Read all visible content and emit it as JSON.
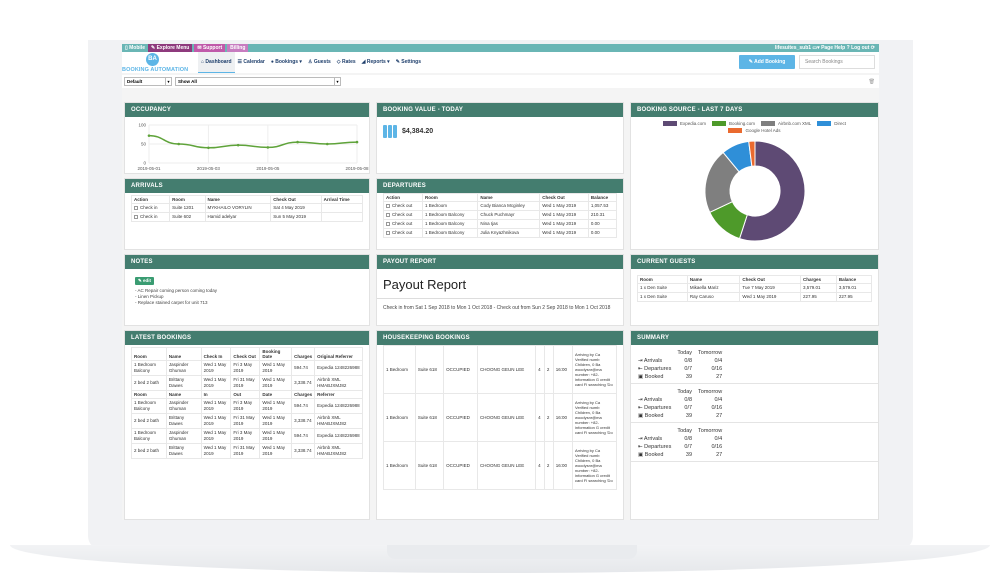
{
  "topbar": {
    "mobile": "Mobile",
    "explore": "Explore Menu",
    "support": "Support",
    "billing": "Billing",
    "user": "lifesuites_sub1",
    "page_help": "Page Help ?",
    "logout": "Log out"
  },
  "navbar": {
    "logo_initials": "BA",
    "logo_text": "BOOKING AUTOMATION",
    "items": [
      "Dashboard",
      "Calendar",
      "Bookings ▾",
      "Guests",
      "Rates",
      "Reports ▾",
      "Settings"
    ],
    "add_booking": "Add Booking",
    "search_placeholder": "Search Bookings"
  },
  "filters": {
    "layout": "Default",
    "show": "Show All"
  },
  "occupancy": {
    "title": "OCCUPANCY",
    "chart_data": {
      "type": "line",
      "x": [
        "2019-05-01",
        "2019-05-02",
        "2019-05-03",
        "2019-05-04",
        "2019-05-05",
        "2019-05-06",
        "2019-05-07",
        "2019-05-08"
      ],
      "values": [
        72,
        50,
        40,
        47,
        41,
        55,
        50,
        55
      ],
      "xticks": [
        "2019-05-01",
        "2019-05-03",
        "2019-05-05",
        "2019-05-08"
      ],
      "yticks": [
        "0",
        "50",
        "100"
      ],
      "ylim": [
        0,
        100
      ],
      "color": "#5fa33a"
    }
  },
  "booking_value": {
    "title": "BOOKING VALUE - TODAY",
    "value": "$4,384.20"
  },
  "booking_source": {
    "title": "BOOKING SOURCE - LAST 7 DAYS",
    "chart_data": {
      "type": "pie",
      "labels": [
        "Expedia.com",
        "Booking.com",
        "Airbnb.com XML",
        "Direct",
        "Google Hotel Ads"
      ],
      "values": [
        55,
        13,
        21,
        9,
        2
      ],
      "colors": [
        "#5e4a74",
        "#4e9a2a",
        "#7f7f7f",
        "#2f8fd8",
        "#ea6a2f"
      ]
    }
  },
  "arrivals": {
    "title": "ARRIVALS",
    "columns": [
      "Action",
      "Room",
      "Name",
      "Check Out",
      "Arrival Time"
    ],
    "rows": [
      {
        "action": "Check in",
        "room": "Suite 1201",
        "name": "MYKHAILO VORYLIN",
        "checkout": "Sat 4 May 2019",
        "time": ""
      },
      {
        "action": "Check in",
        "room": "Suite 602",
        "name": "Hamid adelyar",
        "checkout": "Sun 5 May 2019",
        "time": ""
      }
    ]
  },
  "departures": {
    "title": "DEPARTURES",
    "columns": [
      "Action",
      "Room",
      "Name",
      "Check Out",
      "Balance"
    ],
    "rows": [
      {
        "action": "Check out",
        "room": "1 Bedroom",
        "name": "Cody Bianca Mcginley",
        "checkout": "Wed 1 May 2019",
        "balance": "1,057.53"
      },
      {
        "action": "Check out",
        "room": "1 Bedroom Balcony",
        "name": "Chuck Puchmayr",
        "checkout": "Wed 1 May 2019",
        "balance": "210.31"
      },
      {
        "action": "Check out",
        "room": "1 Bedroom Balcony",
        "name": "Nina Ijas",
        "checkout": "Wed 1 May 2019",
        "balance": "0.00"
      },
      {
        "action": "Check out",
        "room": "1 Bedroom Balcony",
        "name": "Julia Knyazhnikova",
        "checkout": "Wed 1 May 2019",
        "balance": "0.00"
      }
    ]
  },
  "notes": {
    "title": "NOTES",
    "edit": "edit",
    "lines": [
      "- AC Repair coming person coming today",
      "- Linen Pickup",
      "- Replace stained carpet for unit 713"
    ]
  },
  "payout": {
    "title": "PAYOUT REPORT",
    "heading": "Payout Report",
    "subtitle": "Check in from Sat 1 Sep 2018 to Mon 1 Oct 2018 - Check out from Sun 2 Sep 2018 to Mon 1 Oct 2018"
  },
  "current_guests": {
    "title": "CURRENT GUESTS",
    "columns": [
      "Room",
      "Name",
      "Check Out",
      "Charges",
      "Balance"
    ],
    "rows": [
      {
        "room": "1 x Den Suite",
        "name": "Mikaella Mariz",
        "checkout": "Tue 7 May 2019",
        "charges": "3,579.01",
        "balance": "3,579.01"
      },
      {
        "room": "1 x Den Suite",
        "name": "Ray Caruso",
        "checkout": "Wed 1 May 2019",
        "charges": "227.95",
        "balance": "227.95"
      }
    ]
  },
  "latest_bookings": {
    "title": "LATEST BOOKINGS",
    "columns": [
      "Room",
      "Name",
      "Check In",
      "Check Out",
      "Booking Date",
      "Charges",
      "Original Referrer"
    ],
    "columns_short": [
      "Room",
      "Name",
      "In",
      "Out",
      "Date",
      "Charges",
      "Referrer"
    ],
    "rows": [
      {
        "room": "1 Bedroom Balcony",
        "name": "Jaspinder Ghuman",
        "in": "Wed 1 May 2019",
        "out": "Fri 3 May 2019",
        "date": "Wed 1 May 2019",
        "charges": "594.74",
        "ref": "Expedia 1248226988"
      },
      {
        "room": "2 bed 2 bath",
        "name": "Brittany Dawes",
        "in": "Wed 1 May 2019",
        "out": "Fri 31 May 2019",
        "date": "Wed 1 May 2019",
        "charges": "3,338.74",
        "ref": "Airbnb XML HMABJXMJ82"
      }
    ]
  },
  "housekeeping": {
    "title": "HOUSEKEEPING BOOKINGS",
    "rows": [
      {
        "room": "1 Bedroom",
        "unit": "Suite 618",
        "status": "OCCUPIED",
        "name": "CHOONG GEUN LEE",
        "adults": "4",
        "nights": "2",
        "time": "16:00",
        "info": "Arriving by Ca Verified numb Children, 0 Ba woodysnr@ma number: +82- information G credit card Fi searching 'Do"
      }
    ]
  },
  "summary": {
    "title": "SUMMARY",
    "headers": [
      "Today",
      "Tomorrow"
    ],
    "rows": [
      {
        "label": "Arrivals",
        "today": "0/8",
        "tomorrow": "0/4"
      },
      {
        "label": "Departures",
        "today": "0/7",
        "tomorrow": "0/16"
      },
      {
        "label": "Booked",
        "today": "39",
        "tomorrow": "27"
      }
    ]
  }
}
